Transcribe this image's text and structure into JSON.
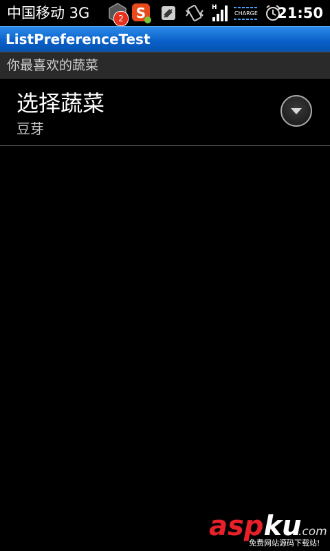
{
  "status_bar": {
    "carrier": "中国移动 3G",
    "notification_count": "2",
    "signal_label": "H",
    "charge_label": "CHARGE",
    "time": "21:50",
    "icons": [
      "app-notification-icon",
      "sogou-input-icon",
      "usb-icon",
      "vibrate-icon",
      "signal-icon",
      "battery-charge-icon",
      "alarm-icon"
    ]
  },
  "app": {
    "title": "ListPreferenceTest"
  },
  "category": {
    "title": "你最喜欢的蔬菜"
  },
  "preference": {
    "title": "选择蔬菜",
    "summary": "豆芽"
  },
  "watermark": {
    "brand_red": "asp",
    "brand_white": "ku",
    "suffix": ".com",
    "subtitle": "免费网站源码下载站!"
  },
  "colors": {
    "title_bar": "#0a60c8",
    "category_bg": "#2a2a2a",
    "background": "#000000",
    "watermark_red": "#e8202a"
  }
}
